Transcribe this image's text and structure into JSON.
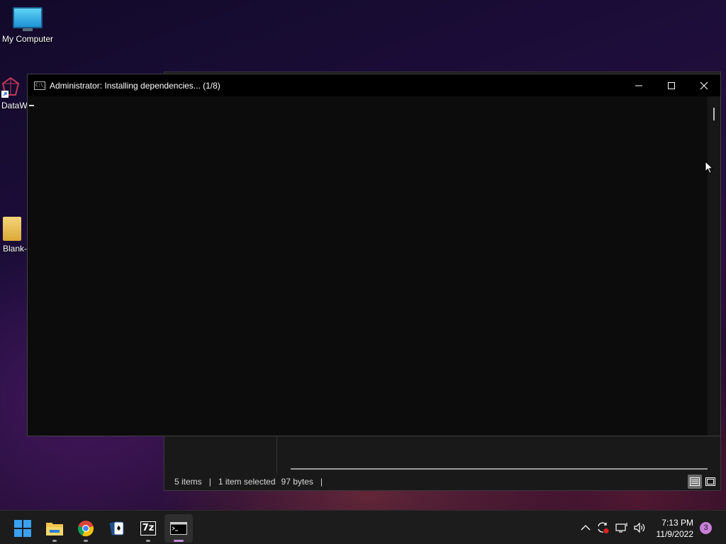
{
  "desktop": {
    "icons": [
      {
        "label": "My Computer"
      },
      {
        "label": "DataW"
      },
      {
        "label": "Blank-"
      }
    ]
  },
  "explorer": {
    "status": {
      "items": "5 items",
      "selected": "1 item selected",
      "size": "97 bytes"
    }
  },
  "console": {
    "title": "Administrator:  Installing dependencies... (1/8)",
    "icon_text": "C:\\_"
  },
  "taskbar": {
    "apps": [
      "start-icon",
      "file-explorer-icon",
      "chrome-icon",
      "solitaire-icon",
      "7zip-icon",
      "terminal-icon"
    ],
    "sevenzip_label": "7z",
    "clock": {
      "time": "7:13 PM",
      "date": "11/9/2022"
    },
    "notifications": "3"
  },
  "colors": {
    "accent": "#c97fd9",
    "console_bg": "#0c0c0c",
    "taskbar_bg": "#1c1c1c"
  }
}
